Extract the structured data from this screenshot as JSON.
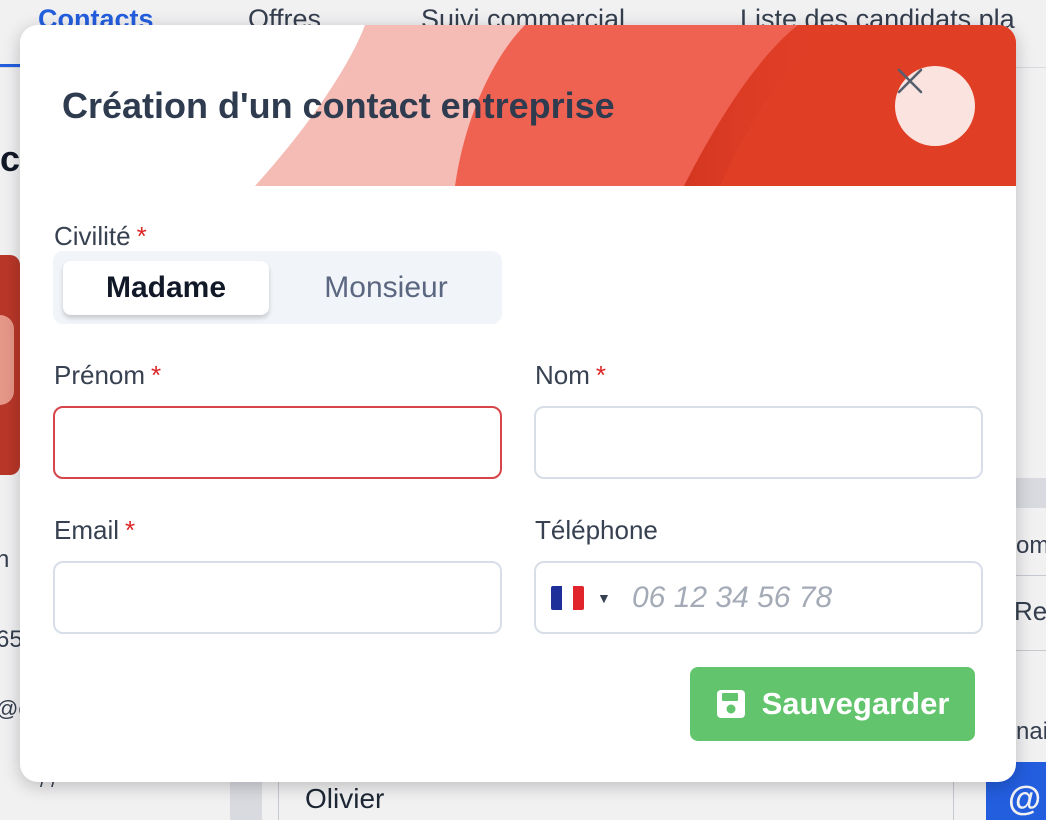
{
  "background": {
    "tabs": [
      "Contacts",
      "Offres",
      "Suivi commercial",
      "Liste des candidats pla"
    ],
    "heading": "c",
    "left_snippets": [
      "n",
      "65",
      "@e",
      "/ /"
    ],
    "right_snippets": [
      "om",
      "Re",
      "nai"
    ],
    "input_value": "Olivier",
    "at_icon": "@"
  },
  "modal": {
    "title": "Création d'un contact entreprise",
    "close_icon": "close-icon",
    "civilite": {
      "label": "Civilité",
      "required_mark": "*",
      "options": [
        "Madame",
        "Monsieur"
      ],
      "selected": "Madame"
    },
    "prenom": {
      "label": "Prénom",
      "required_mark": "*",
      "value": ""
    },
    "nom": {
      "label": "Nom",
      "required_mark": "*",
      "value": ""
    },
    "email": {
      "label": "Email",
      "required_mark": "*",
      "value": ""
    },
    "telephone": {
      "label": "Téléphone",
      "placeholder": "06 12 34 56 78",
      "value": "",
      "country_flag": "france-flag-icon"
    },
    "save_label": "Sauvegarder",
    "save_icon": "floppy-disk-icon"
  },
  "colors": {
    "header_red": "#e13e26",
    "header_coral": "#ef6252",
    "header_pink": "#f5bbb5",
    "required": "#dc2626",
    "error_border": "#d7454a",
    "save_green": "#62c46c",
    "tab_active": "#2563eb"
  }
}
